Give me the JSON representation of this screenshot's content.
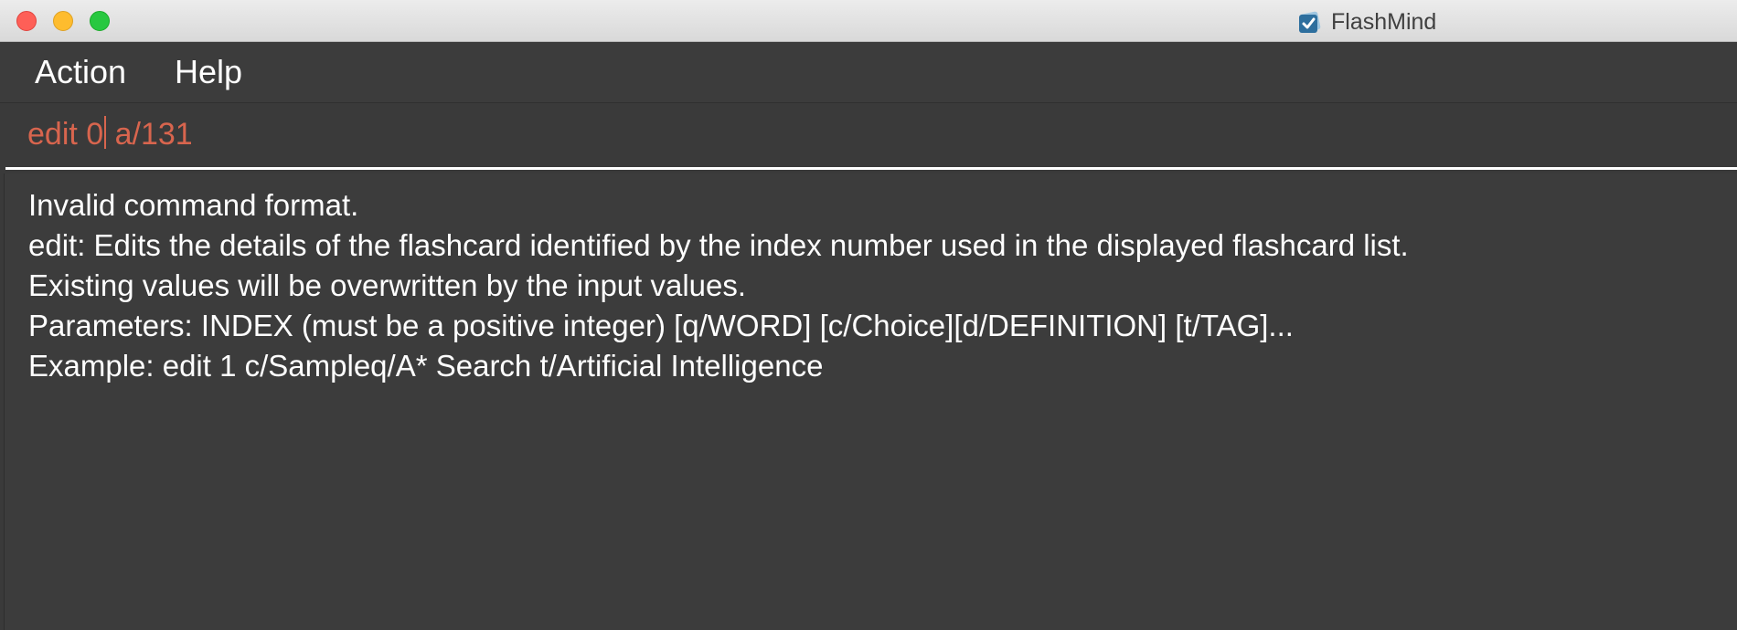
{
  "window": {
    "title": "FlashMind"
  },
  "colors": {
    "command_text": "#d8654e",
    "background": "#3a3a3a",
    "result_text": "#ffffff"
  },
  "menu": {
    "items": [
      {
        "label": "Action"
      },
      {
        "label": "Help"
      }
    ]
  },
  "command_box": {
    "value_before_caret": "edit 0",
    "value_after_caret": " a/131"
  },
  "result_display": {
    "lines": [
      "Invalid command format.",
      "edit: Edits the details of the flashcard identified by the index number used in the displayed flashcard list.",
      "Existing values will be overwritten by the input values.",
      "Parameters: INDEX (must be a positive integer) [q/WORD] [c/Choice][d/DEFINITION] [t/TAG]...",
      "Example: edit 1 c/Sampleq/A* Search t/Artificial Intelligence"
    ]
  }
}
